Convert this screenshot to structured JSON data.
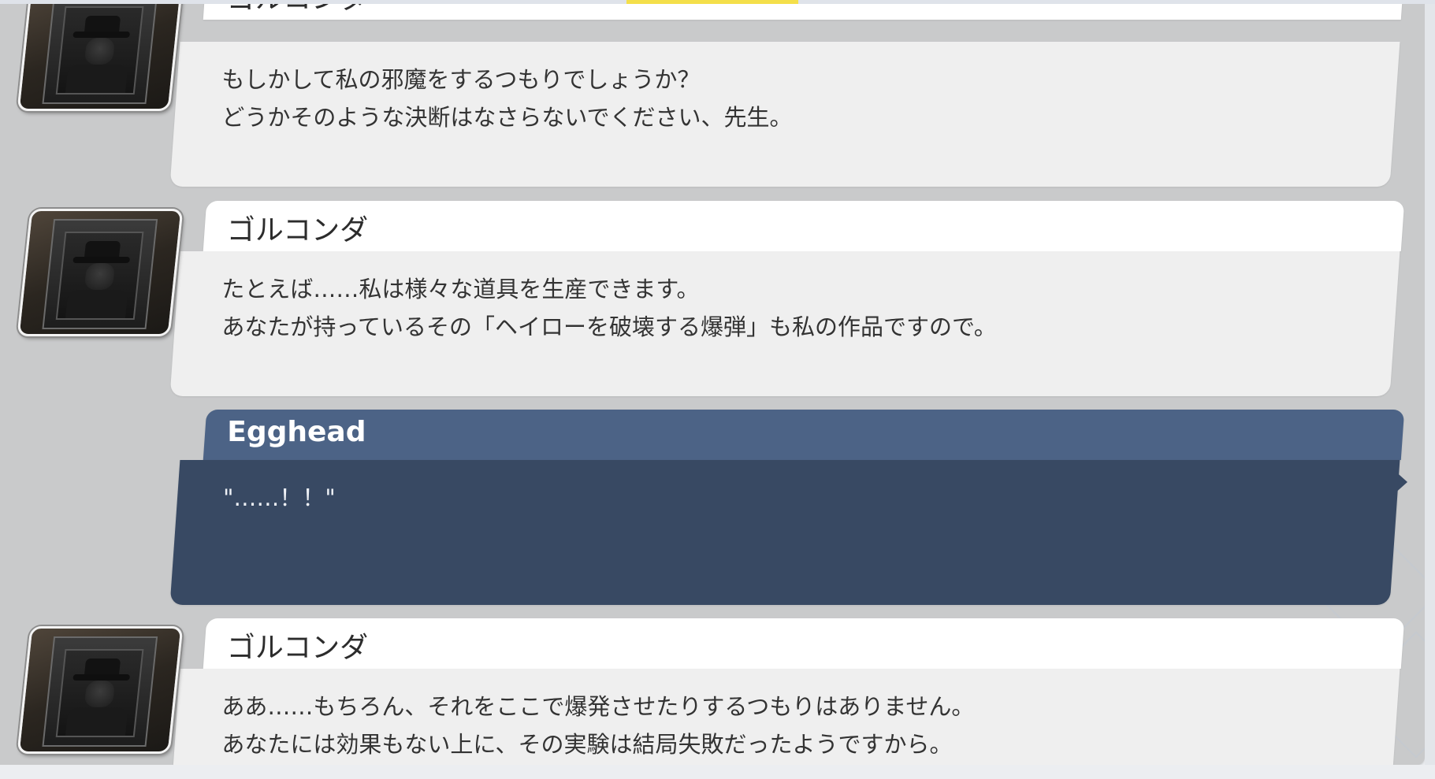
{
  "messages": [
    {
      "speaker": "ゴルコンダ",
      "line1": "もしかして私の邪魔をするつもりでしょうか？",
      "line2": "どうかそのような決断はなさらないでください、先生。"
    },
    {
      "speaker": "ゴルコンダ",
      "line1": "たとえば……私は様々な道具を生産できます。",
      "line2": "あなたが持っているその「ヘイローを破壊する爆弾」も私の作品ですので。"
    },
    {
      "speaker": "Egghead",
      "line1": "\"……！！\"",
      "line2": ""
    },
    {
      "speaker": "ゴルコンダ",
      "line1": "ああ……もちろん、それをここで爆発させたりするつもりはありません。",
      "line2": "あなたには効果もない上に、その実験は結局失敗だったようですから。"
    }
  ],
  "colors": {
    "player_header": "#4c6386",
    "player_body": "#384963",
    "npc_header": "#ffffff",
    "npc_body": "#efefef",
    "panel_bg": "#c9cacb",
    "accent": "#f4df4a"
  },
  "icons": {
    "npc_avatar": "golconde-portrait-icon"
  }
}
